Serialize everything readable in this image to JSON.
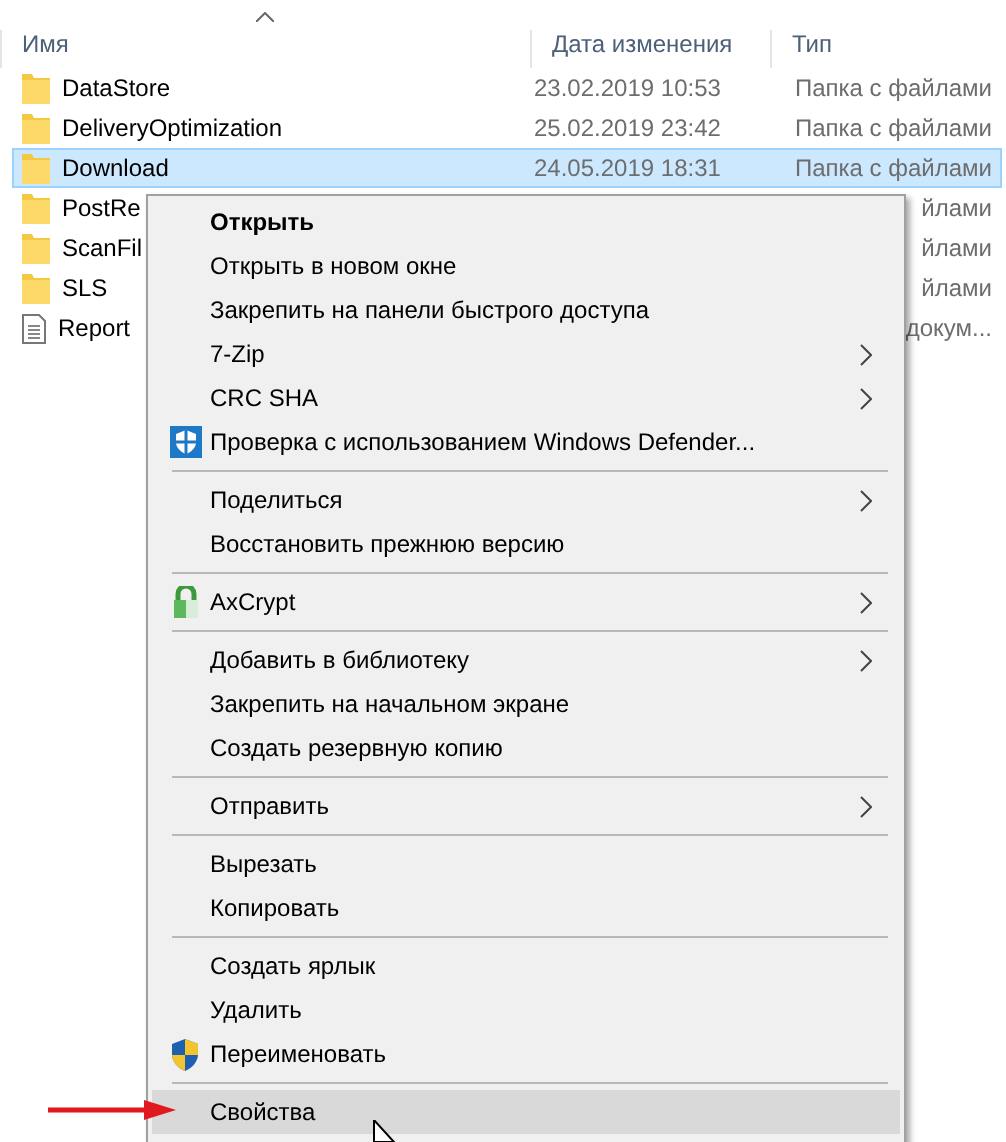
{
  "file_list": {
    "columns": [
      "Имя",
      "Дата изменения",
      "Тип"
    ],
    "rows": [
      {
        "name": "DataStore",
        "date": "23.02.2019 10:53",
        "type": "Папка с файлами",
        "kind": "folder",
        "selected": false
      },
      {
        "name": "DeliveryOptimization",
        "date": "25.02.2019 23:42",
        "type": "Папка с файлами",
        "kind": "folder",
        "selected": false
      },
      {
        "name": "Download",
        "date": "24.05.2019 18:31",
        "type": "Папка с файлами",
        "kind": "folder",
        "selected": true
      },
      {
        "name": "PostRe",
        "type": "йлами",
        "kind": "folder",
        "selected": false
      },
      {
        "name": "ScanFil",
        "type": "йлами",
        "kind": "folder",
        "selected": false
      },
      {
        "name": "SLS",
        "type": "йлами",
        "kind": "folder",
        "selected": false
      },
      {
        "name": "Report",
        "type": "докум...",
        "kind": "document",
        "selected": false
      }
    ]
  },
  "context_menu": {
    "items": [
      {
        "kind": "item",
        "label": "Открыть",
        "default": true,
        "submenu": false,
        "selected": false
      },
      {
        "kind": "item",
        "label": "Открыть в новом окне",
        "default": false,
        "submenu": false,
        "selected": false
      },
      {
        "kind": "item",
        "label": "Закрепить на панели быстрого доступа",
        "default": false,
        "submenu": false,
        "selected": false
      },
      {
        "kind": "item",
        "label": "7-Zip",
        "default": false,
        "submenu": true,
        "selected": false
      },
      {
        "kind": "item",
        "label": "CRC SHA",
        "default": false,
        "submenu": true,
        "selected": false
      },
      {
        "kind": "shield-item",
        "label": "Проверка с использованием Windows Defender...",
        "default": false,
        "submenu": false,
        "selected": false
      },
      {
        "kind": "separator"
      },
      {
        "kind": "item",
        "label": "Поделиться",
        "default": false,
        "submenu": true,
        "selected": false
      },
      {
        "kind": "item",
        "label": "Восстановить прежнюю версию",
        "default": false,
        "submenu": false,
        "selected": false
      },
      {
        "kind": "separator"
      },
      {
        "kind": "lock-item",
        "label": "AxCrypt",
        "default": false,
        "submenu": true,
        "selected": false
      },
      {
        "kind": "separator"
      },
      {
        "kind": "item",
        "label": "Добавить в библиотеку",
        "default": false,
        "submenu": true,
        "selected": false
      },
      {
        "kind": "item",
        "label": "Закрепить на начальном экране",
        "default": false,
        "submenu": false,
        "selected": false
      },
      {
        "kind": "item",
        "label": "Создать резервную копию",
        "default": false,
        "submenu": false,
        "selected": false
      },
      {
        "kind": "separator"
      },
      {
        "kind": "item",
        "label": "Отправить",
        "default": false,
        "submenu": true,
        "selected": false
      },
      {
        "kind": "separator"
      },
      {
        "kind": "item",
        "label": "Вырезать",
        "default": false,
        "submenu": false,
        "selected": false
      },
      {
        "kind": "item",
        "label": "Копировать",
        "default": false,
        "submenu": false,
        "selected": false
      },
      {
        "kind": "separator"
      },
      {
        "kind": "item",
        "label": "Создать ярлык",
        "default": false,
        "submenu": false,
        "selected": false
      },
      {
        "kind": "item",
        "label": "Удалить",
        "default": false,
        "submenu": false,
        "selected": false
      },
      {
        "kind": "uac-item",
        "label": "Переименовать",
        "default": false,
        "submenu": false,
        "selected": false
      },
      {
        "kind": "separator"
      },
      {
        "kind": "item",
        "label": "Свойства",
        "default": false,
        "submenu": false,
        "selected": true
      }
    ]
  }
}
